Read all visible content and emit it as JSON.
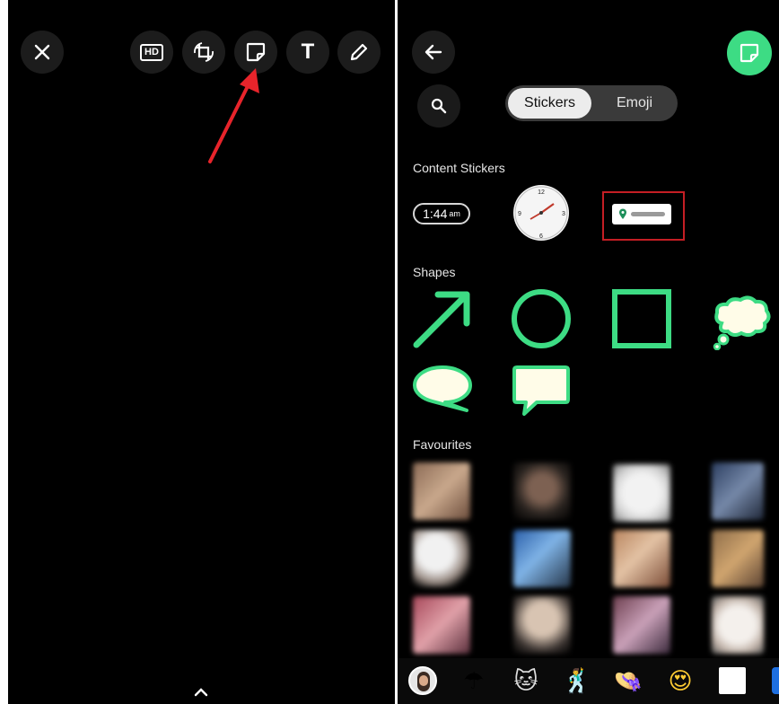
{
  "left_toolbar": {
    "icons": [
      "close-icon",
      "hd-icon",
      "crop-rotate-icon",
      "sticker-icon",
      "text-icon",
      "pencil-icon"
    ],
    "hd_label": "HD",
    "text_label": "T",
    "annotation_color": "#e8242b"
  },
  "right_header": {
    "back_icon": "arrow-left-icon",
    "sticker_button_color": "#3ddc84",
    "search_icon": "search-icon"
  },
  "tabs": {
    "stickers": "Stickers",
    "emoji": "Emoji",
    "active": "Stickers"
  },
  "sections": {
    "content": "Content Stickers",
    "shapes": "Shapes",
    "favourites": "Favourites"
  },
  "content_stickers": {
    "time": "1:44",
    "time_suffix": "am",
    "clock_numbers": [
      "12",
      "3",
      "6",
      "9"
    ],
    "location_icon": "location-pin-icon",
    "highlight_color": "#c41e24"
  },
  "shape_color": "#3ddc84",
  "shapes": [
    "arrow-shape",
    "circle-shape",
    "square-shape",
    "thought-bubble-shape",
    "speech-bubble-oval-shape",
    "speech-bubble-rect-shape"
  ],
  "bottom_bar": {
    "items": [
      "avatar-pack",
      "umbrella-sticker-pack",
      "cat-sticker-pack",
      "person-sticker-pack",
      "hat-sticker-pack",
      "heart-eyes-sticker-pack",
      "meme-sticker-pack"
    ],
    "left_chevron_icon": "chevron-up-icon"
  }
}
